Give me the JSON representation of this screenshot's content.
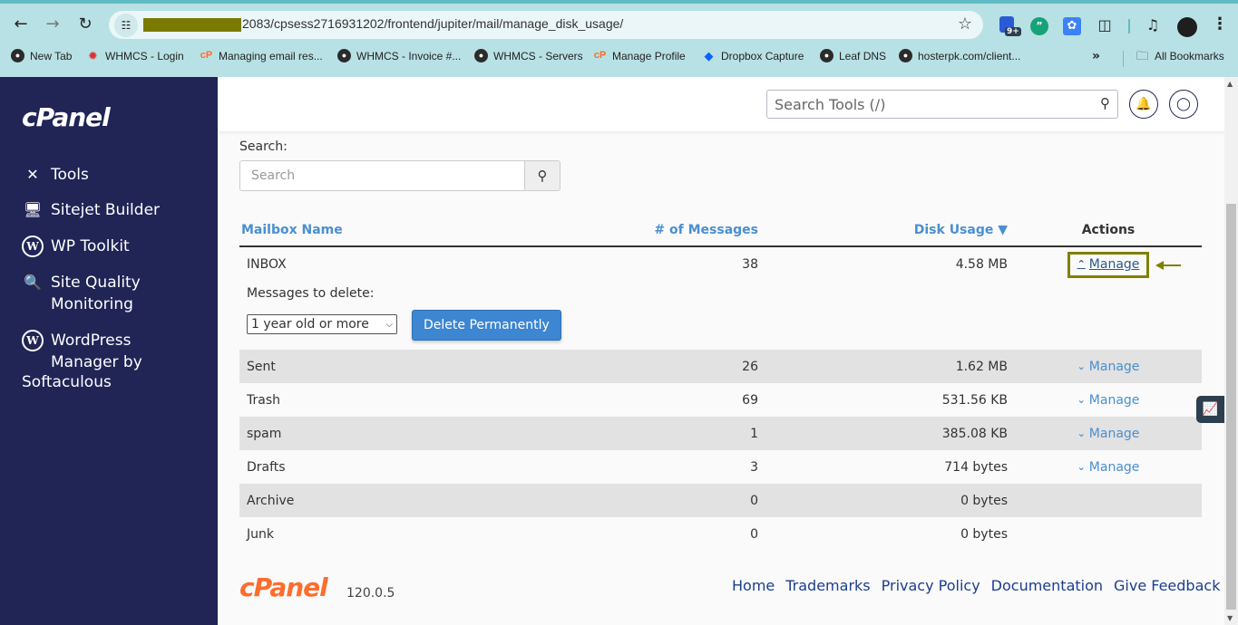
{
  "browser": {
    "url_visible": "2083/cpsess2716931202/frontend/jupiter/mail/manage_disk_usage/",
    "extension_badge": "9+",
    "bookmarks": [
      {
        "label": "New Tab",
        "icon": "globe-icon"
      },
      {
        "label": "WHMCS - Login",
        "icon": "web-icon"
      },
      {
        "label": "Managing email res...",
        "icon": "cpanel-icon"
      },
      {
        "label": "WHMCS - Invoice #...",
        "icon": "globe-icon"
      },
      {
        "label": "WHMCS - Servers",
        "icon": "globe-icon"
      },
      {
        "label": "Manage Profile",
        "icon": "cpanel-icon"
      },
      {
        "label": "Dropbox Capture",
        "icon": "dropbox-icon"
      },
      {
        "label": "Leaf DNS",
        "icon": "globe-icon"
      },
      {
        "label": "hosterpk.com/client...",
        "icon": "globe-icon"
      }
    ],
    "more_bookmarks": "»",
    "all_bookmarks": "All Bookmarks"
  },
  "sidebar": {
    "logo": "cPanel",
    "items": [
      {
        "label": "Tools",
        "icon": "tools-icon"
      },
      {
        "label": "Sitejet Builder",
        "icon": "sitejet-icon"
      },
      {
        "label": "WP Toolkit",
        "icon": "wordpress-icon"
      },
      {
        "label": "Site Quality\nMonitoring",
        "icon": "site-quality-icon"
      },
      {
        "label": "WordPress\nManager by",
        "icon": "wordpress-icon"
      }
    ],
    "item_last_line": "Softaculous"
  },
  "header": {
    "search_placeholder": "Search Tools (/)"
  },
  "main": {
    "search_label": "Search:",
    "search_placeholder": "Search",
    "table": {
      "columns": [
        "Mailbox Name",
        "# of Messages",
        "Disk Usage ▼",
        "Actions"
      ],
      "rows": [
        {
          "name": "INBOX",
          "messages": "38",
          "usage": "4.58 MB",
          "action": "Manage",
          "expanded": true
        },
        {
          "name": "Sent",
          "messages": "26",
          "usage": "1.62 MB",
          "action": "Manage"
        },
        {
          "name": "Trash",
          "messages": "69",
          "usage": "531.56 KB",
          "action": "Manage"
        },
        {
          "name": "spam",
          "messages": "1",
          "usage": "385.08 KB",
          "action": "Manage"
        },
        {
          "name": "Drafts",
          "messages": "3",
          "usage": "714 bytes",
          "action": "Manage"
        },
        {
          "name": "Archive",
          "messages": "0",
          "usage": "0 bytes",
          "action": ""
        },
        {
          "name": "Junk",
          "messages": "0",
          "usage": "0 bytes",
          "action": ""
        }
      ]
    },
    "expand": {
      "label": "Messages to delete:",
      "select_value": "1 year old or more",
      "delete_button": "Delete Permanently"
    }
  },
  "footer": {
    "logo": "cPanel",
    "version": "120.0.5",
    "links": [
      "Home",
      "Trademarks",
      "Privacy Policy",
      "Documentation",
      "Give Feedback"
    ]
  },
  "colors": {
    "sidebar_bg": "#202556",
    "link": "#4a8fd0",
    "primary_button": "#3d86d1",
    "brand_orange": "#ff6c2c",
    "annotation": "#808000"
  }
}
